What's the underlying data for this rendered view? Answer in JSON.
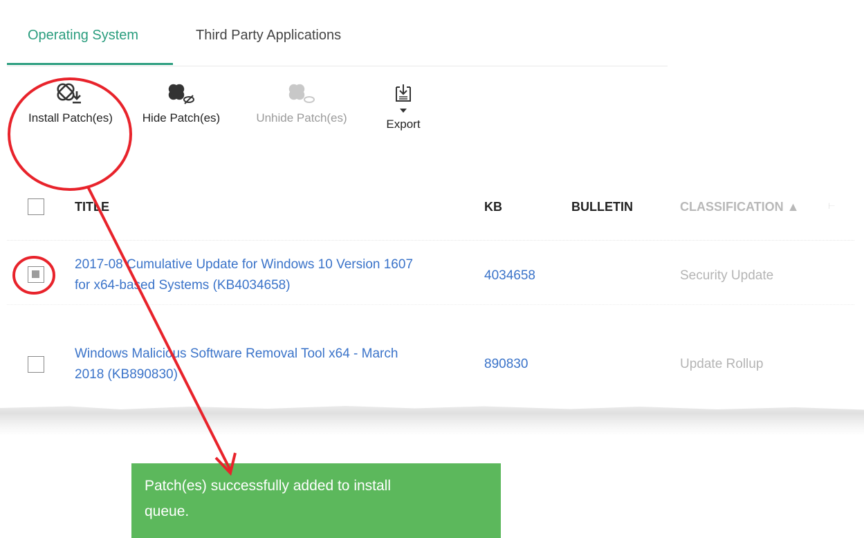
{
  "tabs": {
    "active": "Operating System",
    "inactive": "Third Party Applications"
  },
  "toolbar": {
    "install": "Install Patch(es)",
    "hide": "Hide Patch(es)",
    "unhide": "Unhide Patch(es)",
    "export": "Export"
  },
  "table": {
    "headers": {
      "title": "TITLE",
      "kb": "KB",
      "bulletin": "BULLETIN",
      "classification": "CLASSIFICATION ▲"
    },
    "rows": [
      {
        "title_line1": "2017-08 Cumulative Update for Windows 10 Version 1607",
        "title_line2": "for x64-based Systems (KB4034658)",
        "kb": "4034658",
        "classification": "Security Update",
        "checked": true
      },
      {
        "title_line1": "Windows Malicious Software Removal Tool x64 - March",
        "title_line2": "2018 (KB890830)",
        "kb": "890830",
        "classification": "Update Rollup",
        "checked": false
      }
    ]
  },
  "toast": {
    "line1": "Patch(es) successfully added to install",
    "line2": "queue."
  },
  "colors": {
    "accent": "#2a9d7e",
    "link": "#3a73c9",
    "toast": "#5cb85c",
    "annotation": "#e8232b"
  }
}
